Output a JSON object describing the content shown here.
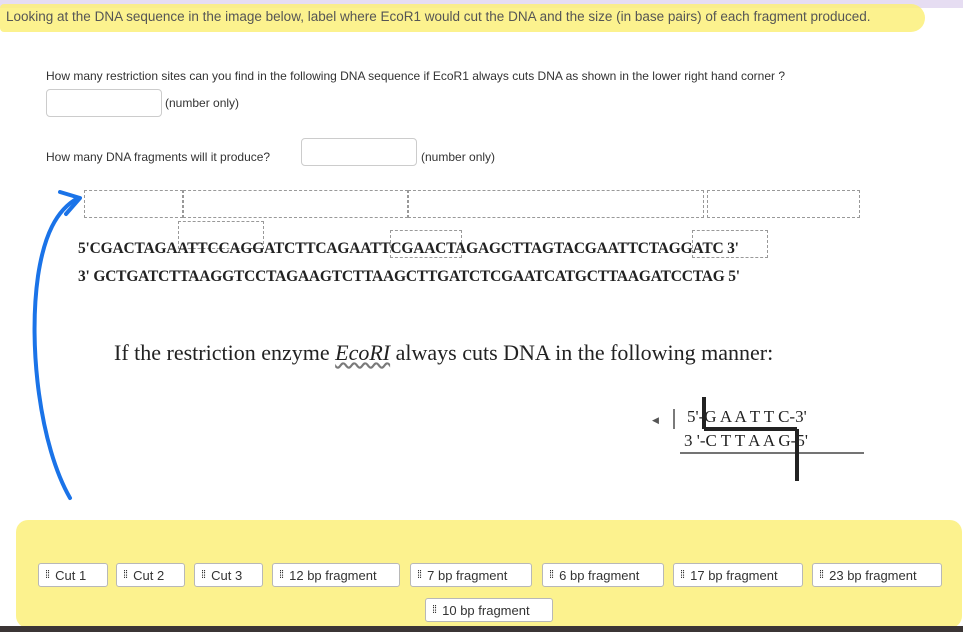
{
  "header": {
    "instruction": "Looking at the DNA sequence in the image below, label where EcoR1 would cut the DNA and the size (in base pairs) of each fragment produced."
  },
  "questions": {
    "q1_text": "How many restriction sites can you find in the following DNA sequence if EcoR1 always cuts DNA as shown in the lower right hand corner ?",
    "q1_hint": "(number only)",
    "q1_value": "",
    "q2_text": "How many DNA fragments will it produce?",
    "q2_hint": "(number only)",
    "q2_value": ""
  },
  "sequence": {
    "top_strand": "5'CGACTAGAATTCCAGGATCTTCAGAATTCGAACTAGAGCTTAGTACGAATTCTAGGATC 3'",
    "bottom_strand": "3' GCTGATCTTAAGGTCCTAGAAGTCTTAAGCTTGATCTCGAATCATGCTTAAGATCCTAG 5'"
  },
  "enzyme": {
    "sentence_before": "If the restriction enzyme ",
    "name": "EcoRI",
    "sentence_after": " always cuts DNA in the following manner:",
    "site_top": "5'-G A A T T C-3'",
    "site_bottom": "3 '-C T T A A G-5'"
  },
  "chips": [
    {
      "label": "Cut 1"
    },
    {
      "label": "Cut 2"
    },
    {
      "label": "Cut 3"
    },
    {
      "label": "12 bp fragment"
    },
    {
      "label": "7 bp fragment"
    },
    {
      "label": "6 bp fragment"
    },
    {
      "label": "17 bp fragment"
    },
    {
      "label": "23 bp fragment"
    },
    {
      "label": "10 bp fragment"
    }
  ],
  "colors": {
    "highlight": "#fbf07a",
    "annotation_arrow": "#1a73e8"
  }
}
